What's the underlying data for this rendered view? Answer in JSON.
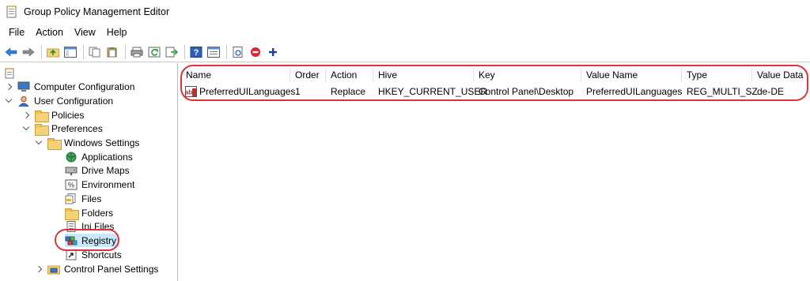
{
  "window": {
    "title": "Group Policy Management Editor"
  },
  "menu": [
    "File",
    "Action",
    "View",
    "Help"
  ],
  "tree": {
    "items": [
      {
        "label": "Computer Configuration"
      },
      {
        "label": "User Configuration"
      },
      {
        "label": "Policies"
      },
      {
        "label": "Preferences"
      },
      {
        "label": "Windows Settings"
      },
      {
        "label": "Applications"
      },
      {
        "label": "Drive Maps"
      },
      {
        "label": "Environment"
      },
      {
        "label": "Files"
      },
      {
        "label": "Folders"
      },
      {
        "label": "Ini Files"
      },
      {
        "label": "Registry"
      },
      {
        "label": "Shortcuts"
      },
      {
        "label": "Control Panel Settings"
      }
    ]
  },
  "list": {
    "columns": [
      "Name",
      "Order",
      "Action",
      "Hive",
      "Key",
      "Value Name",
      "Type",
      "Value Data"
    ],
    "rows": [
      [
        "PreferredUILanguages",
        "1",
        "Replace",
        "HKEY_CURRENT_USER",
        "Control Panel\\Desktop",
        "PreferredUILanguages",
        "REG_MULTI_SZ",
        "de-DE"
      ]
    ]
  },
  "colors": {
    "highlight": "#d9343a",
    "selection": "#cce8ff",
    "accent": "#1e6fd0"
  }
}
